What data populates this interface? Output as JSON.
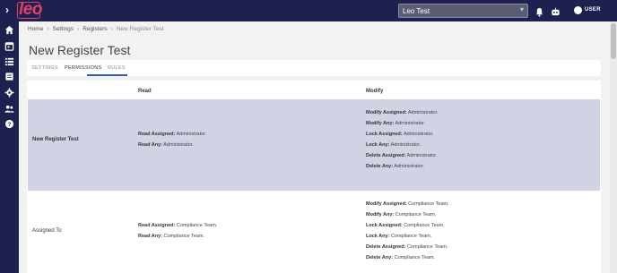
{
  "app": {
    "logo_text": "leo"
  },
  "header": {
    "workspace_select": "Leo Test",
    "user_label": "USER"
  },
  "breadcrumb": [
    "Home",
    "Settings",
    "Registers",
    "New Register Test"
  ],
  "page": {
    "title": "New Register Test"
  },
  "tabs": [
    {
      "label": "SETTINGS",
      "active": false
    },
    {
      "label": "PERMISSIONS",
      "active": true
    },
    {
      "label": "RULES",
      "active": false
    }
  ],
  "table": {
    "headers": {
      "read": "Read",
      "modify": "Modify"
    },
    "rows": [
      {
        "name": "New Register Test",
        "read": [
          {
            "label": "Read Assigned:",
            "value": "Administrator."
          },
          {
            "label": "Read Any:",
            "value": "Administrator."
          }
        ],
        "modify": [
          {
            "label": "Modify Assigned:",
            "value": "Administrator."
          },
          {
            "label": "Modify Any:",
            "value": "Administrator."
          },
          {
            "label": "Lock Assigned:",
            "value": "Administrator."
          },
          {
            "label": "Lock Any:",
            "value": "Administrator."
          },
          {
            "label": "Delete Assigned:",
            "value": "Administrator."
          },
          {
            "label": "Delete Any:",
            "value": "Administrator."
          }
        ]
      },
      {
        "name": "Assigned To",
        "read": [
          {
            "label": "Read Assigned:",
            "value": "Compliance Team."
          },
          {
            "label": "Read Any:",
            "value": "Compliance Team."
          }
        ],
        "modify": [
          {
            "label": "Modify Assigned:",
            "value": "Compliance Team."
          },
          {
            "label": "Modify Any:",
            "value": "Compliance Team."
          },
          {
            "label": "Lock Assigned:",
            "value": "Compliance Team."
          },
          {
            "label": "Lock Any:",
            "value": "Compliance Team."
          },
          {
            "label": "Delete Assigned:",
            "value": "Compliance Team."
          },
          {
            "label": "Delete Any:",
            "value": "Compliance Team."
          }
        ]
      }
    ]
  },
  "colors": {
    "nav_bg": "#1e2150",
    "brand": "#e0406a",
    "accent": "#2d5bbf",
    "highlight_row": "#d0d3e4"
  },
  "icons": {
    "sidebar": [
      "home-icon",
      "calendar-icon",
      "list-icon",
      "register-icon",
      "gear-icon",
      "users-icon",
      "help-icon"
    ],
    "header": [
      "bell-icon",
      "robot-icon",
      "user-avatar-icon"
    ]
  }
}
